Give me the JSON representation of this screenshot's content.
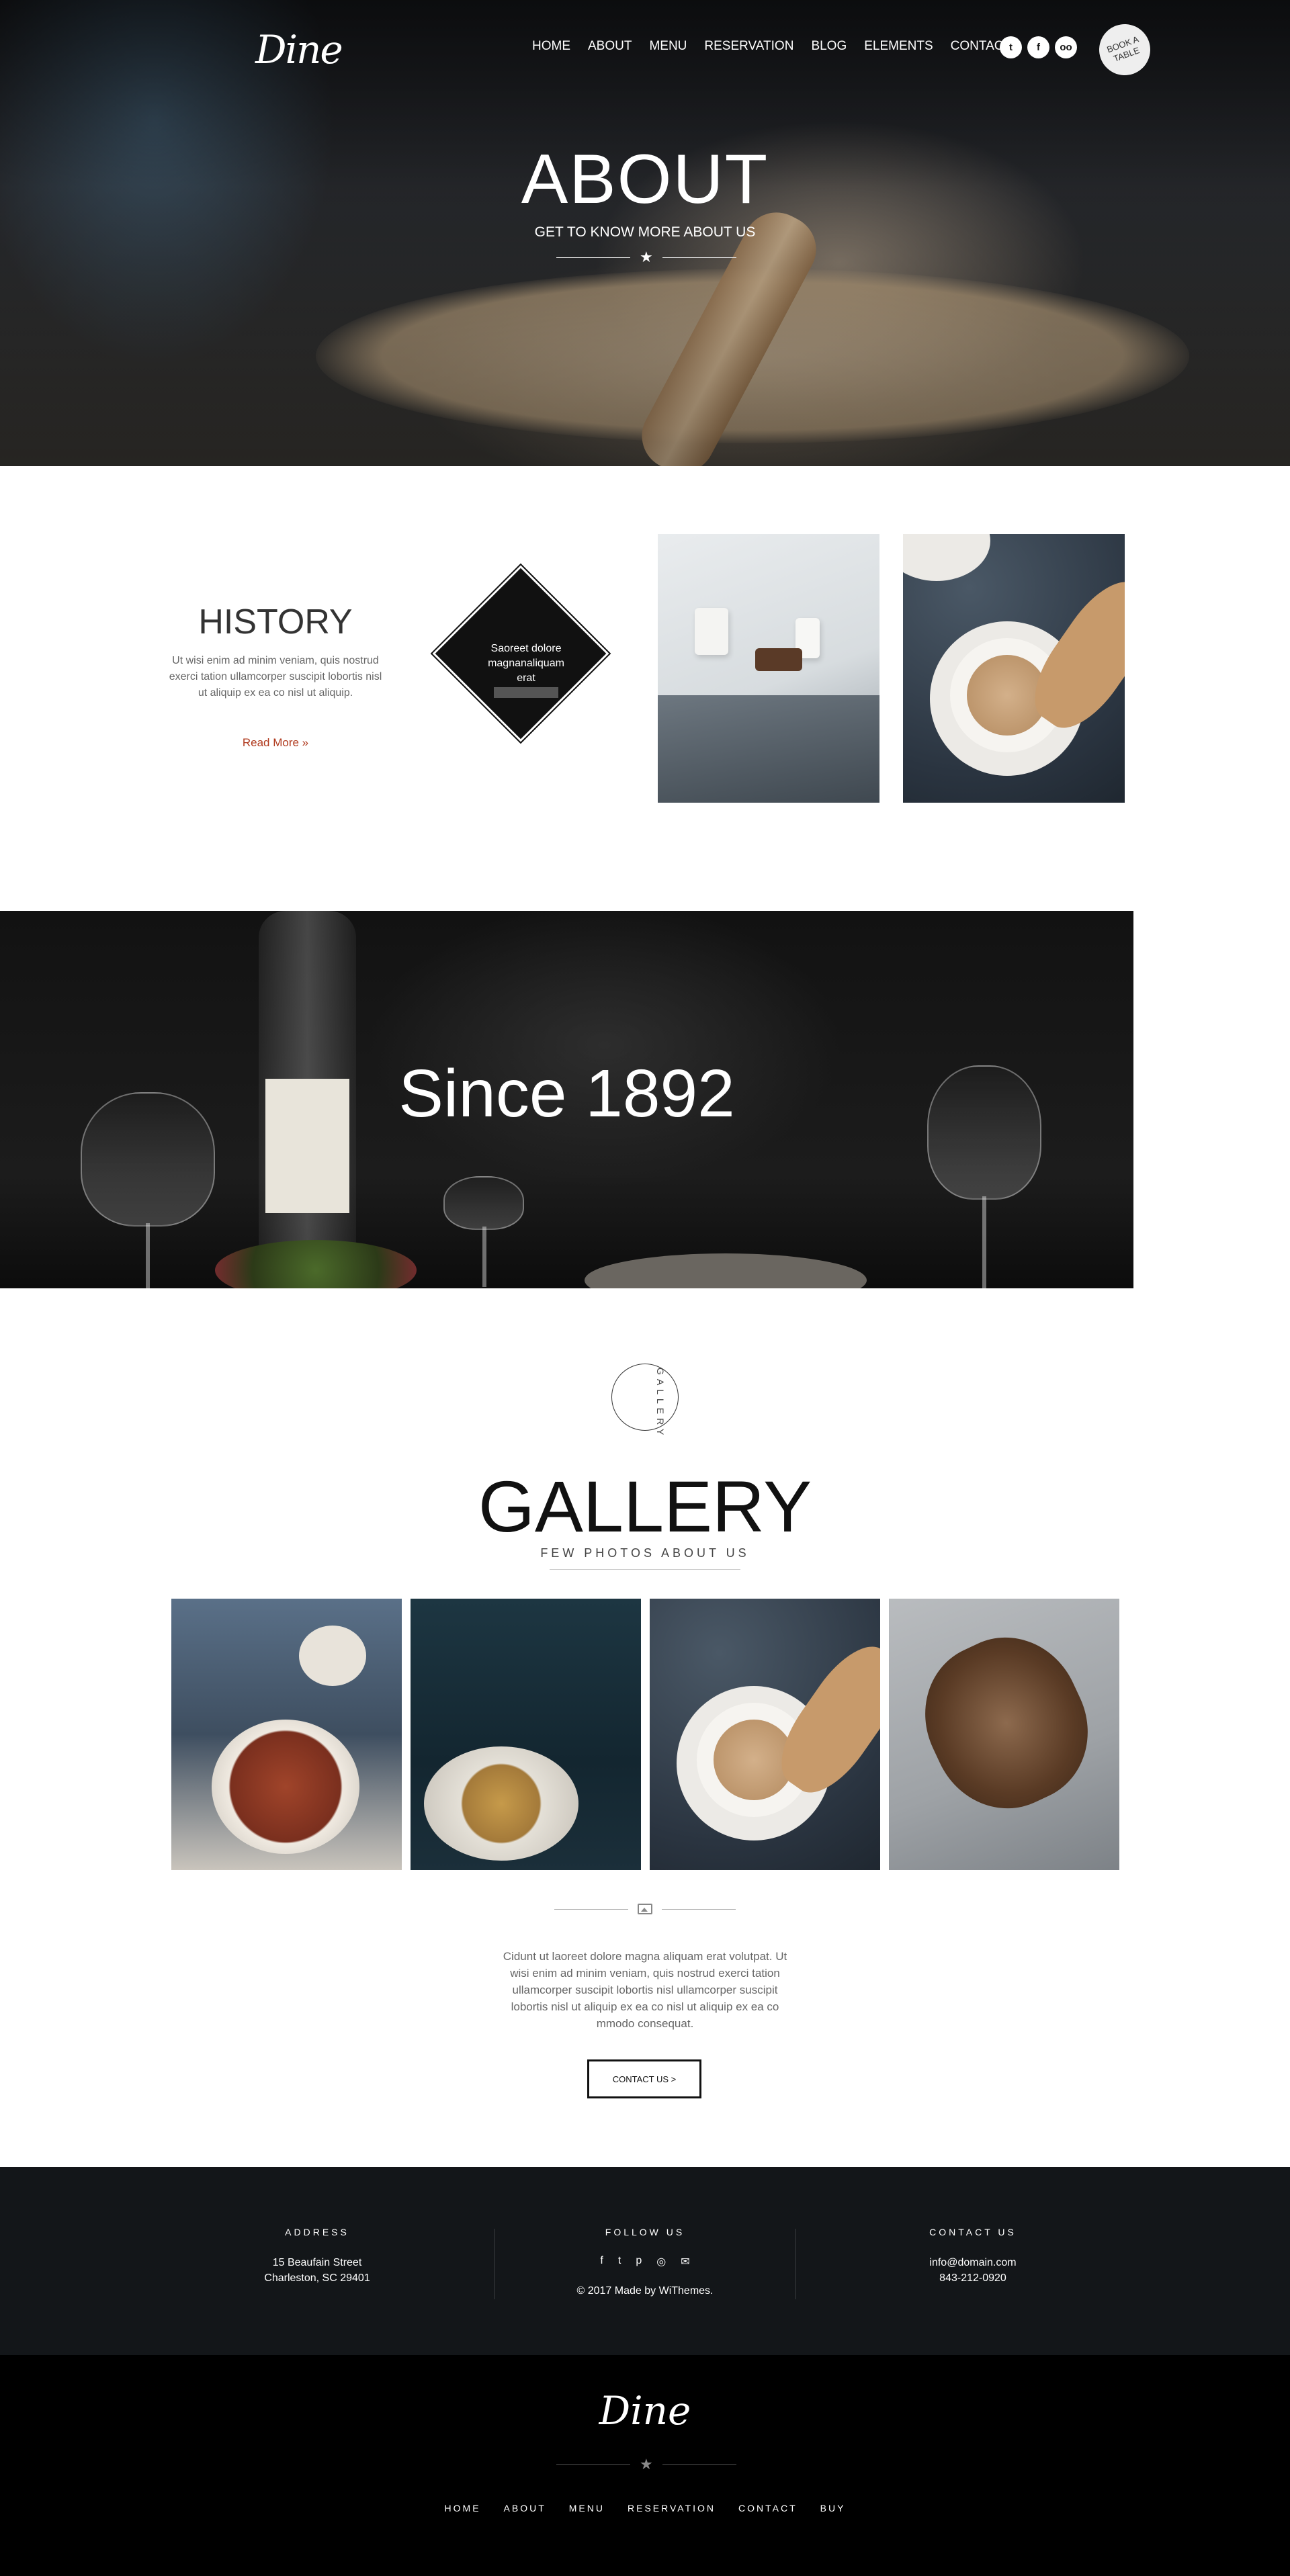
{
  "header": {
    "logo": "Dine",
    "nav": [
      "HOME",
      "ABOUT",
      "MENU",
      "RESERVATION",
      "BLOG",
      "ELEMENTS",
      "CONTACT"
    ],
    "social_icons": [
      "twitter-icon",
      "facebook-icon",
      "tripadvisor-icon"
    ],
    "book_label": "BOOK A TABLE"
  },
  "hero": {
    "title": "ABOUT",
    "subtitle": "GET TO KNOW MORE ABOUT US"
  },
  "history": {
    "title": "HISTORY",
    "text": "Ut wisi enim ad minim veniam, quis nostrud exerci tation ullamcorper suscipit lobortis nisl ut aliquip ex ea co nisl ut aliquip.",
    "link": "Read More »",
    "diamond_text": "Saoreet dolore magnanaliquam erat"
  },
  "banner": {
    "title": "Since 1892"
  },
  "gallery": {
    "badge": "GALLERY",
    "title": "GALLERY",
    "subtitle": "FEW PHOTOS ABOUT US",
    "text": "Cidunt ut laoreet dolore magna aliquam erat volutpat. Ut wisi enim ad minim veniam, quis nostrud exerci tation ullamcorper suscipit lobortis nisl ullamcorper suscipit lobortis nisl ut aliquip ex ea co nisl ut aliquip ex ea co mmodo consequat.",
    "button": "CONTACT US >"
  },
  "footer": {
    "address_title": "ADDRESS",
    "address_line1": "15 Beaufain Street",
    "address_line2": "Charleston, SC 29401",
    "follow_title": "FOLLOW US",
    "follow_icons": [
      "facebook-icon",
      "twitter-icon",
      "pinterest-icon",
      "instagram-icon",
      "email-icon"
    ],
    "copyright": "© 2017 Made by WiThemes.",
    "contact_title": "CONTACT US",
    "email": "info@domain.com",
    "phone": "843-212-0920",
    "logo": "Dine",
    "nav": [
      "HOME",
      "ABOUT",
      "MENU",
      "RESERVATION",
      "CONTACT",
      "BUY"
    ]
  }
}
